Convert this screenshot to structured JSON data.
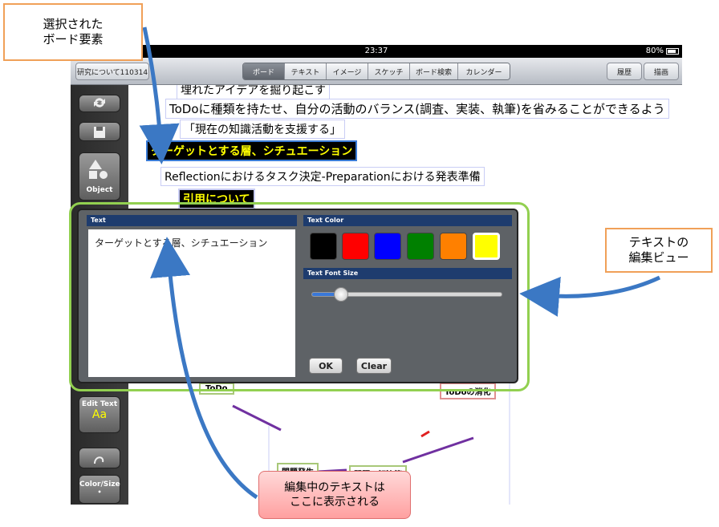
{
  "status": {
    "time": "23:37",
    "battery": "80%"
  },
  "toolbar": {
    "left_button": "研究について110314",
    "tabs": [
      "ボード",
      "テキスト",
      "イメージ",
      "スケッチ",
      "ボード検索",
      "カレンダー"
    ],
    "active_tab": "ボード",
    "history": "履歴",
    "draw": "描画"
  },
  "leftbar": {
    "object": "Object",
    "edit_text": "Edit Text",
    "edit_text_icon": "Aa",
    "color_size": "Color/Size"
  },
  "board": {
    "nodes": [
      "埋れたアイデアを掘り起こす",
      "ToDoに種類を持たせ、自分の活動のバランス(調査、実装、執筆)を省みることができるよう",
      "「現在の知識活動を支援する」",
      "ターゲットとする層、シチュエーション",
      "Reflectionにおけるタスク決定-Preparationにおける発表準備",
      "引用について"
    ],
    "diagram": [
      "ToDo",
      "問題発生",
      "問題の解決策",
      "ToDoの消化",
      "提案"
    ]
  },
  "editor": {
    "text_header": "Text",
    "text_value": "ターゲットとする層、シチュエーション",
    "color_header": "Text Color",
    "colors": [
      "#000000",
      "#ff0000",
      "#0000ff",
      "#008000",
      "#ff8000",
      "#ffff00"
    ],
    "selected_color": "#ffff00",
    "font_header": "Text Font Size",
    "font_size_level": 0.12,
    "ok": "OK",
    "clear": "Clear"
  },
  "annotations": {
    "selected": "選択された\nボード要素",
    "edit_view": "テキストの\n編集ビュー",
    "shown_here": "編集中のテキストは\nここに表示される"
  }
}
